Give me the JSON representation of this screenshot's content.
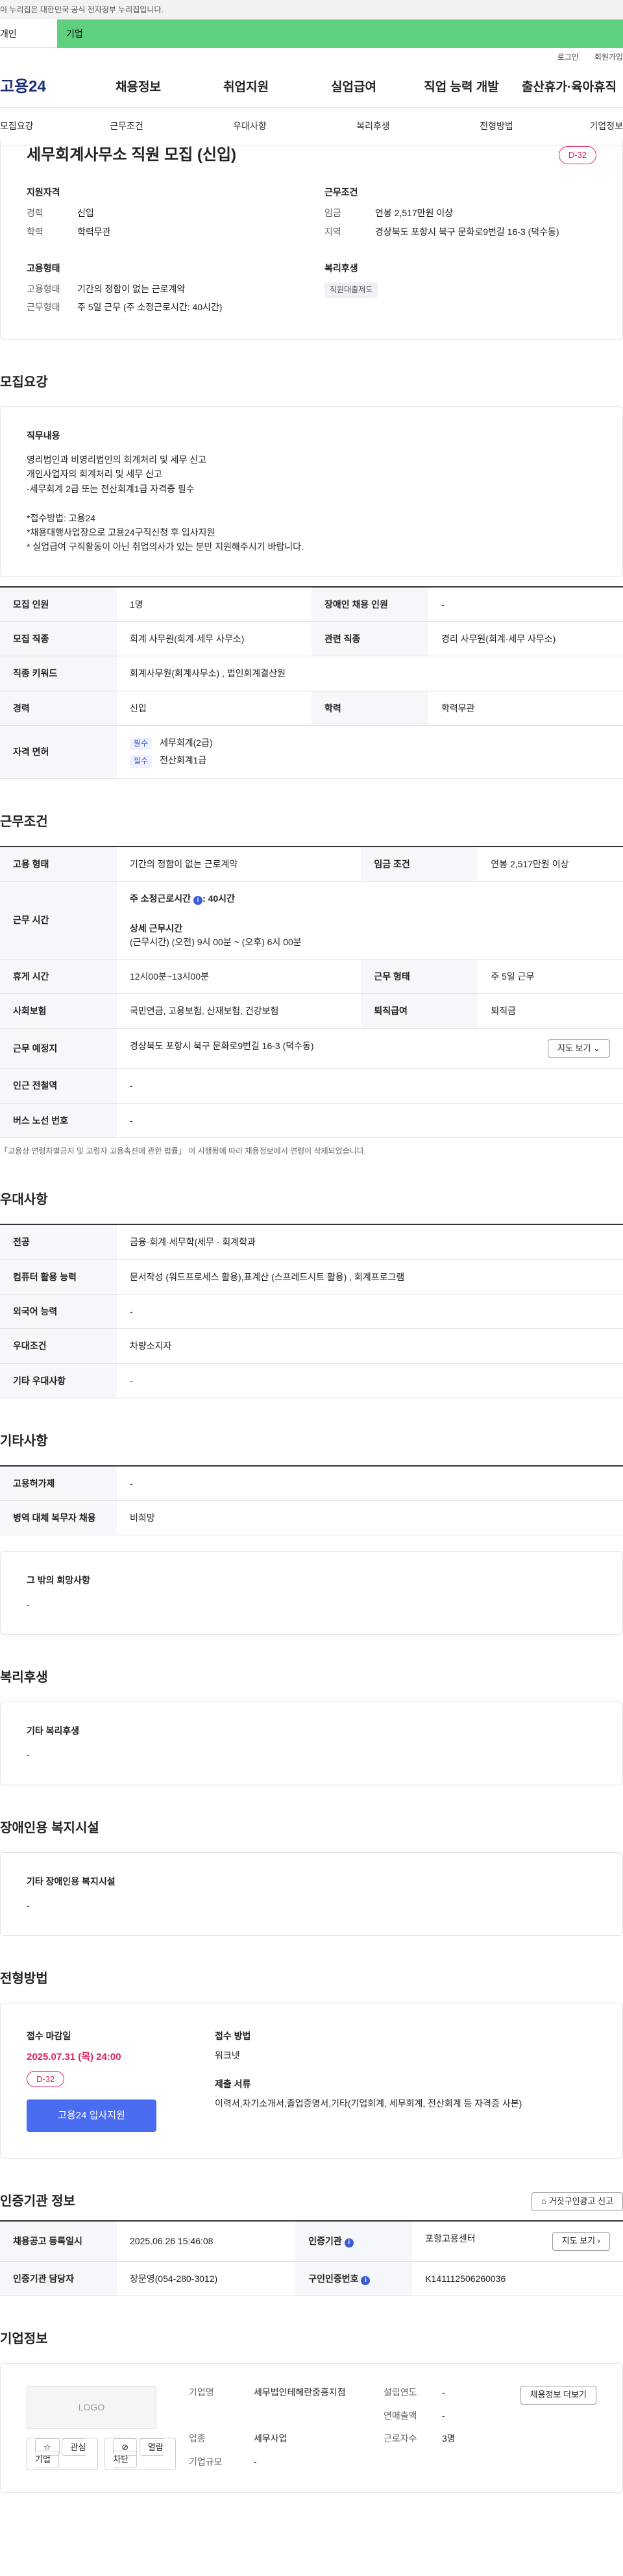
{
  "gov_banner": "이 누리집은 대한민국 공식 전자정부 누리집입니다.",
  "topbar": {
    "tab_a": "개인",
    "tab_b": "기업"
  },
  "util": {
    "login": "로그인",
    "join": "회원가입"
  },
  "gnb": {
    "logo": "고용24",
    "menus": [
      "채용정보",
      "취업지원",
      "실업급여",
      "직업 능력 개발",
      "출산휴가·육아휴직"
    ]
  },
  "subtabs": [
    "모집요강",
    "근무조건",
    "우대사항",
    "복리후생",
    "전형방법",
    "기업정보"
  ],
  "summary": {
    "title": "세무회계사무소 직원 모집 (신입)",
    "dday": "D-32",
    "qual_h": "지원자격",
    "career_k": "경력",
    "career_v": "신입",
    "edu_k": "학력",
    "edu_v": "학력무관",
    "cond_h": "근무조건",
    "wage_k": "임금",
    "wage_v": "연봉 2,517만원 이상",
    "area_k": "지역",
    "area_v": "경상북도 포항시 북구 문화로9번길 16-3 (덕수동)",
    "emp_h": "고용형태",
    "emp_k": "고용형태",
    "emp_v": "기간의 정함이 없는 근로계약",
    "work_k": "근무형태",
    "work_v": "주 5일 근무 (주 소정근로시간: 40시간)",
    "welfare_h": "복리후생",
    "welfare_chip": "직원대출제도"
  },
  "recruit": {
    "title": "모집요강",
    "duty_h": "직무내용",
    "duty_lines": [
      "영리법인과 비영리법인의 회계처리 및 세무 신고",
      "개인사업자의 회계처리 및 세무 신고",
      "-세무회계 2급 또는 전산회계1급 자격증 필수",
      "",
      "*접수방법: 고용24",
      "*채용대행사업장으로 고용24구직신청 후 입사지원",
      "* 실업급여 구직활동이 아닌 취업의사가 있는 분만 지원해주시기 바랍니다."
    ],
    "rows": {
      "num_k": "모집 인원",
      "num_v": "1명",
      "dis_k": "장애인 채용 인원",
      "dis_v": "-",
      "job_k": "모집 직종",
      "job_v": "회계 사무원(회계·세무 사무소)",
      "rel_k": "관련 직종",
      "rel_v": "경리 사무원(회계·세무 사무소)",
      "kw_k": "직종 키워드",
      "kw_v": "회계사무원(회계사무소) , 법인회계결산원",
      "car_k": "경력",
      "car_v": "신입",
      "edu_k": "학력",
      "edu_v": "학력무관",
      "lic_k": "자격 면허",
      "req": "필수",
      "lic1": "세무회계(2급)",
      "lic2": "전산회계1급"
    }
  },
  "work": {
    "title": "근무조건",
    "type_k": "고용 형태",
    "type_v": "기간의 정함이 없는 근로계약",
    "wage_k": "임금 조건",
    "wage_v": "연봉 2,517만원 이상",
    "time_k": "근무 시간",
    "time_week": "주 소정근로시간",
    "time_week_v": ": 40시간",
    "time_detail_h": "상세 근무시간",
    "time_detail": "(근무시간) (오전) 9시 00분 ~ (오후) 6시 00분",
    "rest_k": "휴게 시간",
    "rest_v": "12시00분~13시00분",
    "form_k": "근무 형태",
    "form_v": "주 5일 근무",
    "ins_k": "사회보험",
    "ins_v": "국민연금, 고용보험, 산재보험, 건강보험",
    "ret_k": "퇴직급여",
    "ret_v": "퇴직금",
    "loc_k": "근무 예정지",
    "loc_v": "경상북도 포항시 북구 문화로9번길 16-3 (덕수동)",
    "map_btn": "지도 보기",
    "sub_k": "인근 전철역",
    "sub_v": "-",
    "bus_k": "버스 노선 번호",
    "bus_v": "-",
    "note": "「고용상 연령차별금지 및 고령자 고용촉진에 관한 법률」 이 시행됨에 따라 채용정보에서 연령이 삭제되었습니다."
  },
  "pref": {
    "title": "우대사항",
    "major_k": "전공",
    "major_v": "금융·회계·세무학(세무 · 회계학과",
    "pc_k": "컴퓨터 활용 능력",
    "pc_v": "문서작성 (워드프로세스 활용),표계산 (스프레드시트 활용) , 회계프로그램",
    "lang_k": "외국어 능력",
    "lang_v": "-",
    "cond_k": "우대조건",
    "cond_v": "차량소지자",
    "etc_k": "기타 우대사항",
    "etc_v": "-"
  },
  "etc": {
    "title": "기타사항",
    "w_k": "고용허가제",
    "w_v": "-",
    "mil_k": "병역 대체 복무자 채용",
    "mil_v": "비희망",
    "hope_h": "그 밖의 희망사항",
    "hope_v": "-"
  },
  "welfare": {
    "title": "복리후생",
    "h": "기타 복리후생",
    "v": "-"
  },
  "disab": {
    "title": "장애인용 복지시설",
    "h": "기타 장애인용 복지시설",
    "v": "-"
  },
  "select": {
    "title": "전형방법",
    "deadline_h": "접수 마감일",
    "deadline": "2025.07.31 (목) 24:00",
    "dday": "D-32",
    "apply": "고용24 입사지원",
    "method_h": "접수 방법",
    "method_v": "워크넷",
    "docs_h": "제출 서류",
    "docs_v": "이력서,자기소개서,졸업증명서,기타(기업회계, 세무회계, 전산회계 등 자격증 사본)"
  },
  "cert": {
    "title": "인증기관 정보",
    "report_btn": "거짓구인광고 신고",
    "reg_k": "채용공고 등록일시",
    "reg_v": "2025.06.26 15:46:08",
    "org_k": "인증기관",
    "org_v": "포항고용센터",
    "map_btn": "지도 보기",
    "mgr_k": "인증기관 담당자",
    "mgr_v": "장문영(054-280-3012)",
    "no_k": "구인인증번호",
    "no_v": "K141112506260036"
  },
  "company": {
    "title": "기업정보",
    "logo": "LOGO",
    "fav": "관심기업",
    "block": "열람차단",
    "info_btn": "채용정보 더보기",
    "name_k": "기업명",
    "name_v": "세무법인테헤란중흥지점",
    "year_k": "설립연도",
    "year_v": "-",
    "sales_k": "연매출액",
    "sales_v": "-",
    "ind_k": "업종",
    "ind_v": "세무사업",
    "emp_k": "근로자수",
    "emp_v": "3명",
    "size_k": "기업규모",
    "size_v": "-"
  }
}
